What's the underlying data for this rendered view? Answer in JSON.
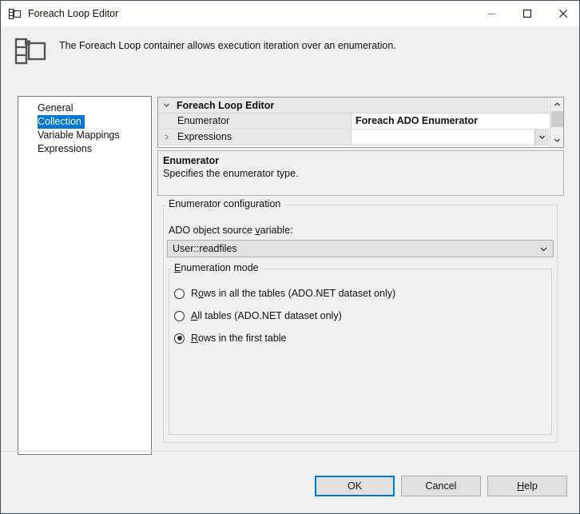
{
  "window": {
    "title": "Foreach Loop Editor",
    "icon": "foreach-loop-icon",
    "controls": {
      "minimize": "minimize-icon",
      "maximize": "maximize-icon",
      "close": "close-icon"
    }
  },
  "header": {
    "icon": "foreach-loop-icon",
    "description": "The Foreach Loop container allows execution iteration over an enumeration."
  },
  "sidebar": {
    "items": [
      {
        "label": "General",
        "selected": false
      },
      {
        "label": "Collection",
        "selected": true
      },
      {
        "label": "Variable Mappings",
        "selected": false
      },
      {
        "label": "Expressions",
        "selected": false
      }
    ]
  },
  "property_grid": {
    "category": "Foreach Loop Editor",
    "category_expander": "chevron-down-icon",
    "rows": [
      {
        "name": "Enumerator",
        "value": "Foreach ADO Enumerator",
        "expander": "",
        "has_dropdown": false
      },
      {
        "name": "Expressions",
        "value": "",
        "expander": "chevron-right-icon",
        "has_dropdown": true
      }
    ],
    "scrollbar": {
      "up": "scroll-up-arrow-icon",
      "down": "scroll-down-arrow-icon"
    }
  },
  "description_panel": {
    "title": "Enumerator",
    "text": "Specifies the enumerator type."
  },
  "enumerator_configuration": {
    "legend": "Enumerator configuration",
    "variable_label_pre": "ADO object source ",
    "variable_label_accel": "v",
    "variable_label_post": "ariable:",
    "variable_value": "User::readfiles",
    "dropdown_icon": "chevron-down-icon",
    "enumeration_mode": {
      "legend_accel": "E",
      "legend_rest": "numeration mode",
      "options": [
        {
          "accel": "R",
          "pre": "",
          "mid": "o",
          "post": "ws in all the tables (ADO.NET dataset only)",
          "label": "Rows in all the tables (ADO.NET dataset only)",
          "selected": false
        },
        {
          "accel": "A",
          "post": "ll tables (ADO.NET dataset only)",
          "label": "All tables (ADO.NET dataset only)",
          "selected": false
        },
        {
          "accel": "R",
          "post": "ows in the first table",
          "label": "Rows in the first table",
          "selected": true
        }
      ]
    }
  },
  "footer": {
    "ok": "OK",
    "cancel": "Cancel",
    "help_accel": "H",
    "help_rest": "elp"
  },
  "colors": {
    "accent": "#0078d7",
    "window_border": "#3c5064",
    "body_background": "#f0f0f0"
  }
}
